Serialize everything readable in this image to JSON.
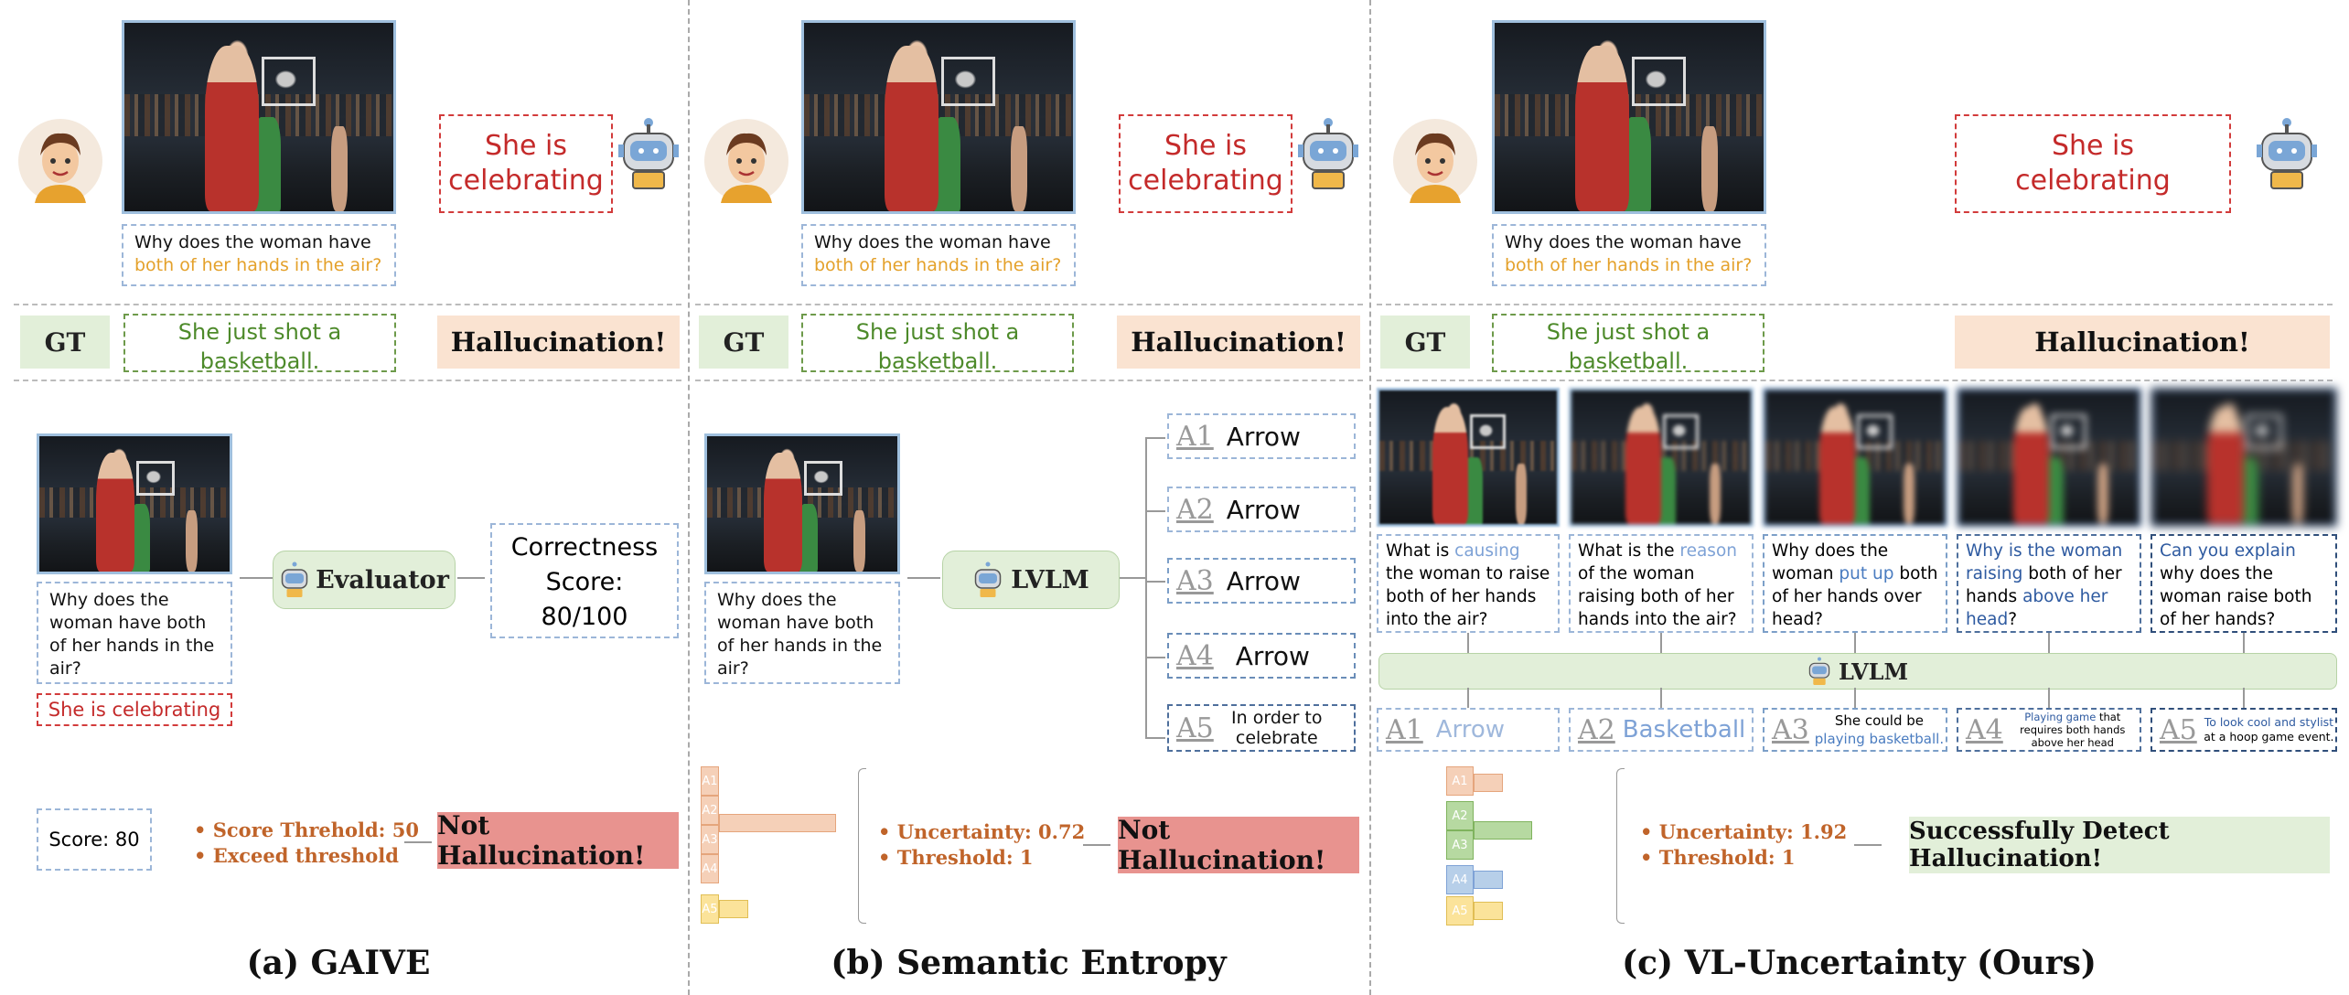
{
  "user_question_line1": "Why does the woman have",
  "user_question_line2": "both of her hands in the air?",
  "model_answer_line1": "She is",
  "model_answer_line2": "celebrating",
  "gt_label": "GT",
  "gt_answer_line1": "She just shot a",
  "gt_answer_line2": "basketball.",
  "hallucination_label": "Hallucination!",
  "panel_a": {
    "caption": "(a) GAIVE",
    "question": "Why does the woman have both of her hands in the air?",
    "answer": "She is celebrating",
    "evaluator": "Evaluator",
    "score_line1": "Correctness",
    "score_line2": "Score:",
    "score_line3": "80/100",
    "score_box": "Score: 80",
    "bullets": [
      "Score Threhold: 50",
      "Exceed threshold"
    ],
    "verdict": "Not Hallucination!"
  },
  "panel_b": {
    "caption": "(b) Semantic Entropy",
    "question": "Why does the woman have both of her hands in the air?",
    "model": "LVLM",
    "answers": [
      {
        "label": "A1",
        "text": "Arrow"
      },
      {
        "label": "A2",
        "text": "Arrow"
      },
      {
        "label": "A3",
        "text": "Arrow"
      },
      {
        "label": "A4",
        "text": "Arrow"
      },
      {
        "label": "A5",
        "text": "In order to celebrate"
      }
    ],
    "bar_labels": [
      "A1",
      "A2",
      "A3",
      "A4",
      "A5"
    ],
    "bar_values": [
      0.8,
      0.2
    ],
    "bullets": [
      "Uncertainty: 0.72",
      "Threshold: 1"
    ],
    "verdict": "Not Hallucination!"
  },
  "panel_c": {
    "caption": "(c) VL-Uncertainty (Ours)",
    "model": "LVLM",
    "questions": [
      {
        "pre": "What is ",
        "hl": "causing",
        "post": " the woman to raise both of her hands into the air?"
      },
      {
        "pre": "What is the ",
        "hl": "reason",
        "post": " of the woman raising both of her hands into the air?"
      },
      {
        "pre": "Why does the woman ",
        "hl": "put up",
        "post": " both of her hands over head?"
      },
      {
        "pre": "",
        "hl": "Why is the woman raising",
        "post": " both of her hands ",
        "hl2": "above her head",
        "post2": "?"
      },
      {
        "pre": "",
        "hl": "Can you explain",
        "post": " why does the woman raise both of her hands?"
      }
    ],
    "answers": [
      {
        "label": "A1",
        "text": "Arrow"
      },
      {
        "label": "A2",
        "text": "Basketball"
      },
      {
        "label": "A3",
        "pre": "She could be",
        "hl": "playing basketball."
      },
      {
        "label": "A4",
        "hl": "Playing game",
        "post": "that requires both hands above her head"
      },
      {
        "label": "A5",
        "hl": "To look cool and stylist",
        "post": "at a hoop game event."
      }
    ],
    "bar_labels": [
      "A1",
      "A2",
      "A3",
      "A4",
      "A5"
    ],
    "bar_values": [
      0.2,
      0.4,
      0.2,
      0.2
    ],
    "bullets": [
      "Uncertainty: 1.92",
      "Threshold: 1"
    ],
    "verdict": "Successfully Detect Hallucination!"
  },
  "colors": {
    "gt_bg": "#e2efd9",
    "hallucination_bg": "#fae3d1",
    "not_hallu_bg": "#e8938f",
    "success_bg": "#e2efd9",
    "accent_blue": "#4a7cc0"
  },
  "icons": [
    "user-avatar-icon",
    "robot-icon"
  ]
}
